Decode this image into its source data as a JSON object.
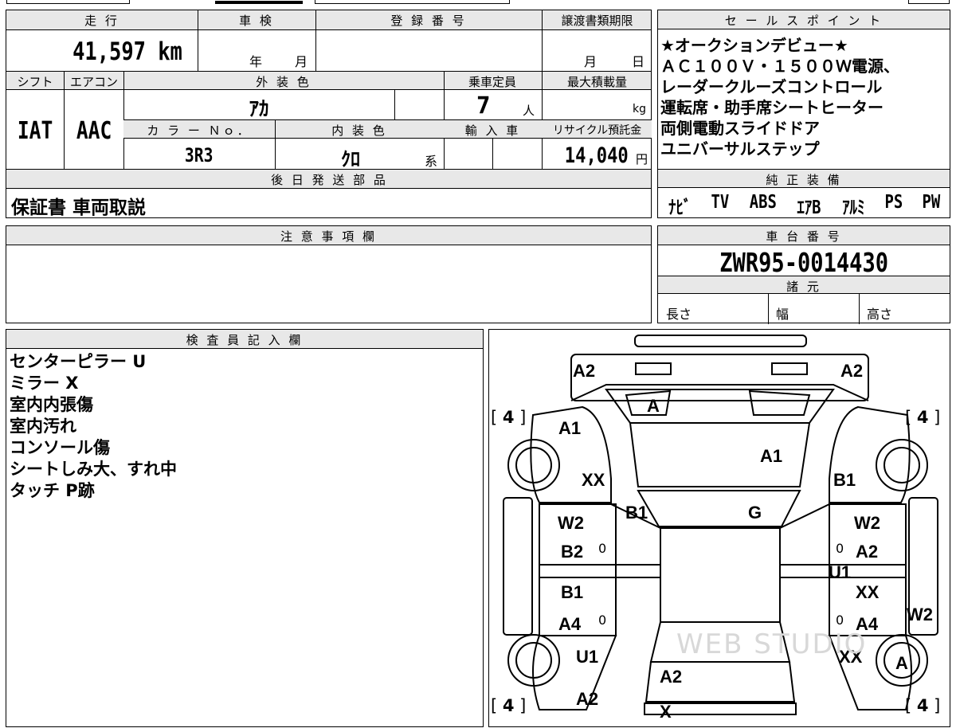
{
  "top_strip": {
    "text": ""
  },
  "odometer": {
    "label": "走 行",
    "value": "41,597 km"
  },
  "shaken": {
    "label": "車 検",
    "year_unit": "年",
    "month_unit": "月"
  },
  "registration": {
    "label": "登 録 番 号",
    "value": ""
  },
  "transfer_deadline": {
    "label": "譲渡書類期限",
    "month_unit": "月",
    "day_unit": "日"
  },
  "sales_points": {
    "label": "セ ー ル ス ポ イ ン ト",
    "lines": [
      "★オークションデビュー★",
      "ＡＣ１００Ｖ・１５００Ｗ電源、",
      "レーダークルーズコントロール",
      "運転席・助手席シートヒーター",
      "両側電動スライドドア",
      "ユニバーサルステップ"
    ]
  },
  "shift": {
    "label": "シフト",
    "value": "IAT"
  },
  "aircon": {
    "label": "エアコン",
    "value": "AAC"
  },
  "exterior_color": {
    "label": "外 装 色",
    "value": "ｱｶ"
  },
  "capacity": {
    "label": "乗車定員",
    "value": "7",
    "unit": "人"
  },
  "max_load": {
    "label": "最大積載量",
    "unit": "kg"
  },
  "color_no": {
    "label": "カ ラ ー Ｎｏ．",
    "value": "3R3"
  },
  "interior_color": {
    "label": "内 装 色",
    "value": "ｸﾛ",
    "suffix": "系"
  },
  "import": {
    "label": "輸 入 車"
  },
  "recycle": {
    "label": "リサイクル預託金",
    "value": "14,040",
    "unit": "円"
  },
  "later_parts": {
    "label": "後 日 発 送 部 品",
    "value": "保証書 車両取説"
  },
  "genuine_equipment": {
    "label": "純 正 装 備",
    "items": [
      "ﾅﾋﾞ",
      "TV",
      "ABS",
      "ｴｱB",
      "ｱﾙﾐ",
      "PS",
      "PW"
    ]
  },
  "notes": {
    "label": "注 意 事 項 欄",
    "value": ""
  },
  "chassis": {
    "label": "車 台 番 号",
    "value": "ZWR95-0014430"
  },
  "specs": {
    "label": "諸 元",
    "length": "長さ",
    "width": "幅",
    "height": "高さ"
  },
  "inspector": {
    "label": "検 査 員 記 入 欄",
    "lines": [
      "センターピラー U",
      "ミラー X",
      "室内内張傷",
      "室内汚れ",
      "コンソール傷",
      "シートしみ大、すれ中",
      "タッチ P跡"
    ]
  },
  "diagram": {
    "labels": {
      "front_left": "A2",
      "front_right": "A2",
      "windshield": "A",
      "hood_left": "A1",
      "hood_center": "A1",
      "left_fender": "XX",
      "right_fender": "B1",
      "left_pillar": "B1",
      "roof_front": "G",
      "left_door1_a": "W2",
      "left_door1_b": "B2",
      "right_door1_a": "W2",
      "right_door1_b": "A2",
      "right_pillar": "U1",
      "left_door2_a": "B1",
      "left_door2_b": "A4",
      "right_door2_a": "XX",
      "right_door2_b": "A4",
      "right_step": "W2",
      "left_rear_fender": "U1",
      "right_rear_fender": "XX",
      "right_rear_wheel": "A",
      "rear_center": "A2",
      "rear_left": "A2",
      "rear_bottom": "X"
    },
    "tyres": [
      "4",
      "4",
      "4",
      "4"
    ],
    "zeros": [
      "0",
      "0",
      "0",
      "0"
    ],
    "watermark": "WEB STUDIO"
  }
}
